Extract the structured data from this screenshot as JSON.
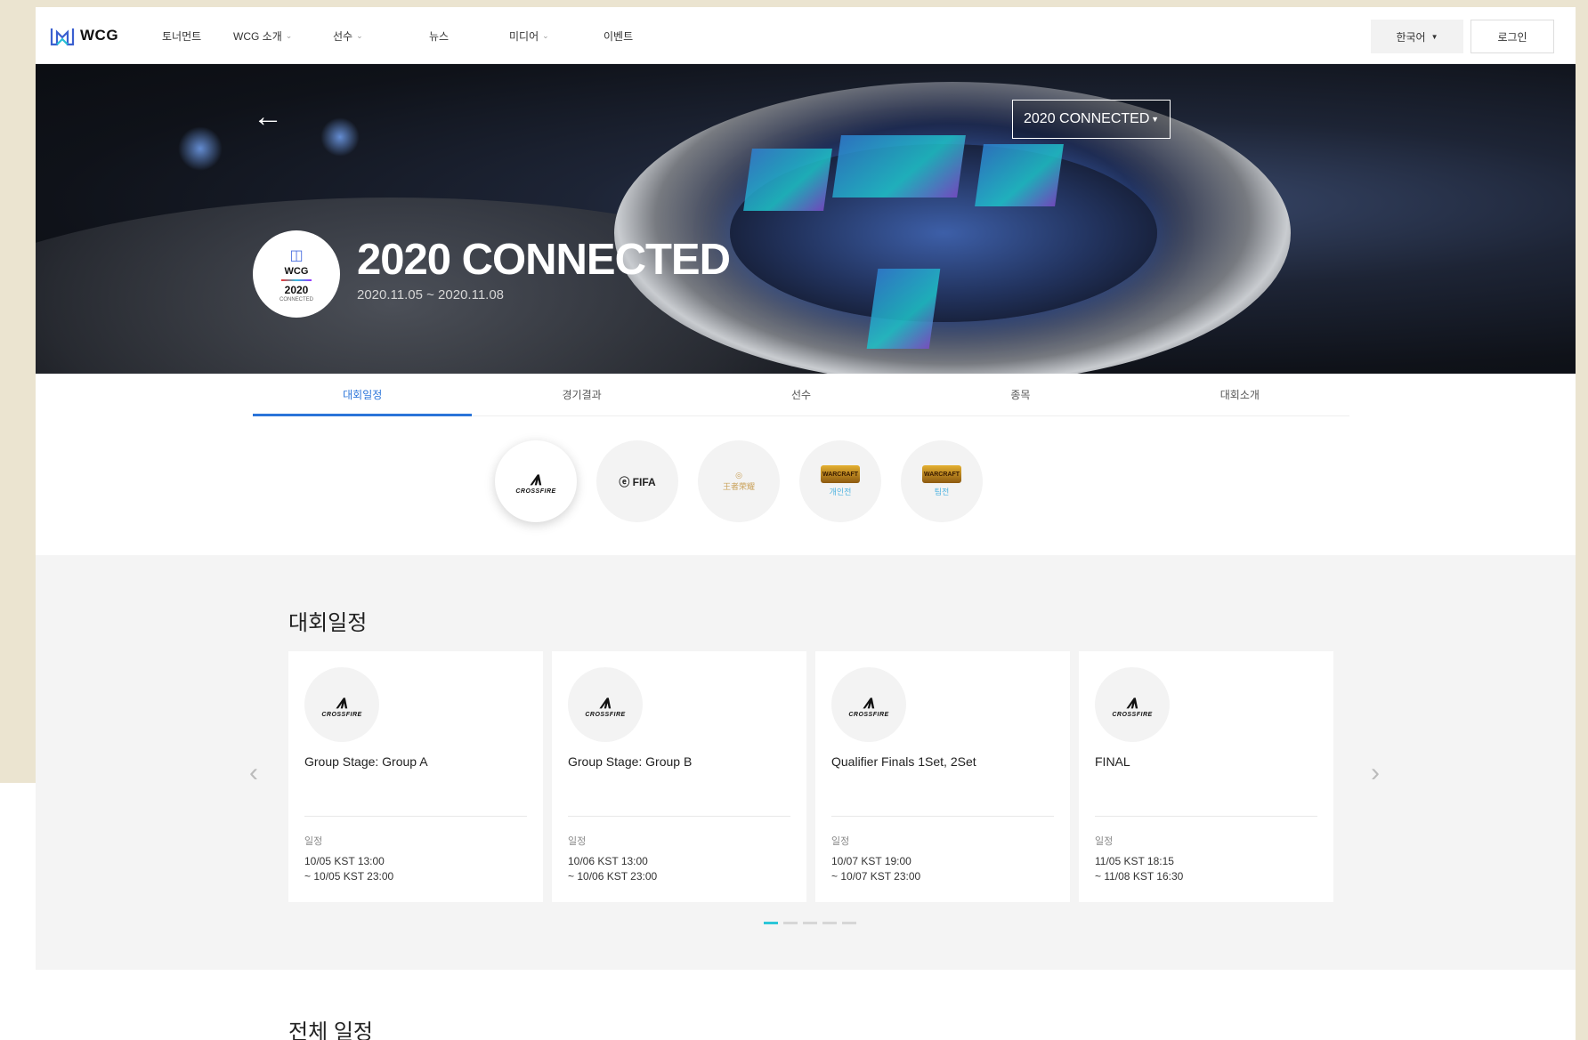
{
  "nav": {
    "brand": "WCG",
    "menu": [
      {
        "label": "토너먼트",
        "caret": false
      },
      {
        "label": "WCG 소개",
        "caret": true
      },
      {
        "label": "선수",
        "caret": true
      },
      {
        "label": "뉴스",
        "caret": false
      },
      {
        "label": "미디어",
        "caret": true
      },
      {
        "label": "이벤트",
        "caret": false
      }
    ],
    "language": "한국어",
    "login": "로그인"
  },
  "hero": {
    "back_icon": "arrow-left-icon",
    "event_select": "2020 CONNECTED",
    "badge": {
      "brand": "WCG",
      "year": "2020",
      "sub": "CONNECTED"
    },
    "title": "2020 CONNECTED",
    "dates": "2020.11.05 ~ 2020.11.08"
  },
  "tabs": [
    "대회일정",
    "경기결과",
    "선수",
    "종목",
    "대회소개"
  ],
  "active_tab": 0,
  "games": [
    {
      "name": "crossfire",
      "label": "CROSSFIRE",
      "sub": ""
    },
    {
      "name": "fifa-online",
      "label": "FIFA",
      "sub": ""
    },
    {
      "name": "king-of-kings",
      "label": "王者荣耀",
      "sub": ""
    },
    {
      "name": "warcraft-solo",
      "label": "WARCRAFT",
      "sub": "개인전"
    },
    {
      "name": "warcraft-team",
      "label": "WARCRAFT",
      "sub": "팀전"
    }
  ],
  "schedule": {
    "title": "대회일정",
    "cards": [
      {
        "game": "CROSSFIRE",
        "title": "Group Stage: Group A",
        "label": "일정",
        "time": [
          "10/05 KST 13:00",
          "~ 10/05 KST 23:00"
        ]
      },
      {
        "game": "CROSSFIRE",
        "title": "Group Stage: Group B",
        "label": "일정",
        "time": [
          "10/06 KST 13:00",
          "~ 10/06 KST 23:00"
        ]
      },
      {
        "game": "CROSSFIRE",
        "title": "Qualifier Finals 1Set, 2Set",
        "label": "일정",
        "time": [
          "10/07 KST 19:00",
          "~ 10/07 KST 23:00"
        ]
      },
      {
        "game": "CROSSFIRE",
        "title": "FINAL",
        "label": "일정",
        "time": [
          "11/05 KST 18:15",
          "~ 11/08 KST 16:30"
        ]
      }
    ],
    "pages": 5,
    "active_page": 0
  },
  "all_schedule": {
    "title": "전체 일정"
  },
  "colors": {
    "accent": "#2a74d9",
    "dot_active": "#2cc6d8",
    "outer_bg": "#ebe4d0"
  }
}
